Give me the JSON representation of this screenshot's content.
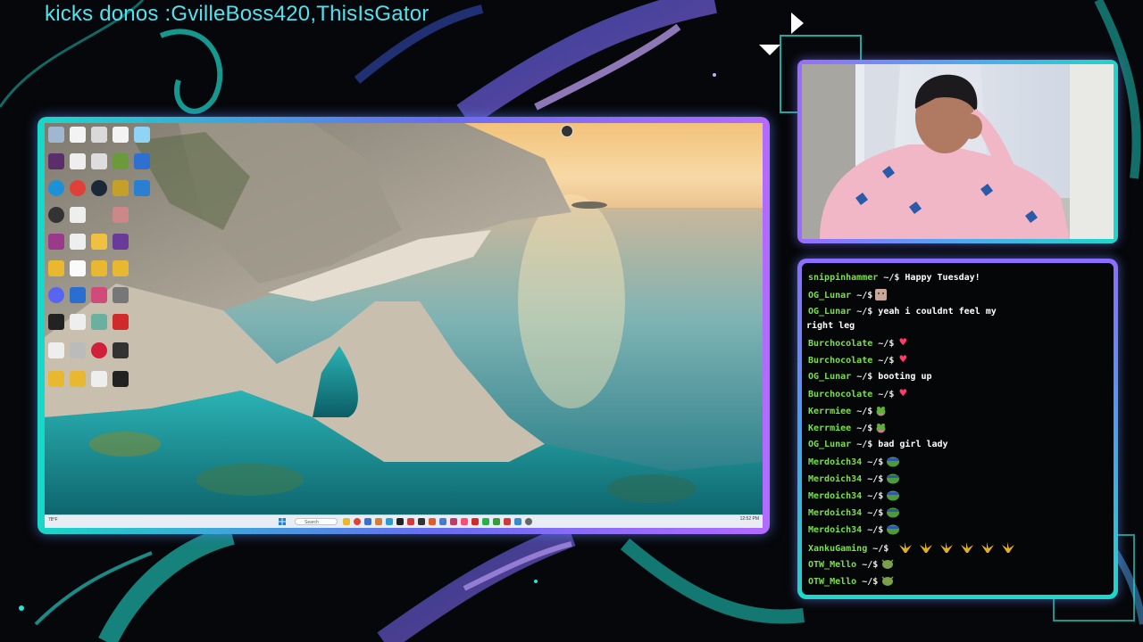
{
  "ticker": {
    "text": "kicks donos :GvilleBoss420,ThisIsGator"
  },
  "colors": {
    "accent_cyan": "#1fd6c8",
    "accent_purple": "#9b6bff",
    "chat_username": "#7be04b",
    "ticker_text": "#4fe3f0"
  },
  "screen": {
    "taskbar": {
      "search_placeholder": "Search",
      "weather": "78°F",
      "time": "12:52 PM"
    }
  },
  "chat": {
    "messages": [
      {
        "user": "snippinhammer",
        "prompt": "~/$",
        "text": "Happy Tuesday!"
      },
      {
        "user": "OG_Lunar",
        "prompt": "~/$",
        "emote": "face-emote"
      },
      {
        "user": "OG_Lunar",
        "prompt": "~/$",
        "text": "yeah i couldnt feel my"
      },
      {
        "continuation": "right leg"
      },
      {
        "user": "Burchocolate",
        "prompt": "~/$",
        "emote": "heart-emote"
      },
      {
        "user": "Burchocolate",
        "prompt": "~/$",
        "emote": "heart-emote"
      },
      {
        "user": "OG_Lunar",
        "prompt": "~/$",
        "text": "booting up"
      },
      {
        "user": "Burchocolate",
        "prompt": "~/$",
        "emote": "heart-emote"
      },
      {
        "user": "Kerrmiee",
        "prompt": "~/$",
        "emote": "frog-emote"
      },
      {
        "user": "Kerrmiee",
        "prompt": "~/$",
        "emote": "frog-emote"
      },
      {
        "user": "OG_Lunar",
        "prompt": "~/$",
        "text": "bad girl lady"
      },
      {
        "user": "Merdoich34",
        "prompt": "~/$",
        "emote": "pepe-emote"
      },
      {
        "user": "Merdoich34",
        "prompt": "~/$",
        "emote": "pepe-emote"
      },
      {
        "user": "Merdoich34",
        "prompt": "~/$",
        "emote": "pepe-emote"
      },
      {
        "user": "Merdoich34",
        "prompt": "~/$",
        "emote": "pepe-emote"
      },
      {
        "user": "Merdoich34",
        "prompt": "~/$",
        "emote": "pepe-emote"
      },
      {
        "user": "XankuGaming",
        "prompt": "~/$",
        "emote": "leaf-emote-x6"
      },
      {
        "user": "OTW_Mello",
        "prompt": "~/$",
        "emote": "bug-emote"
      },
      {
        "user": "OTW_Mello",
        "prompt": "~/$",
        "emote": "bug-emote"
      }
    ]
  }
}
